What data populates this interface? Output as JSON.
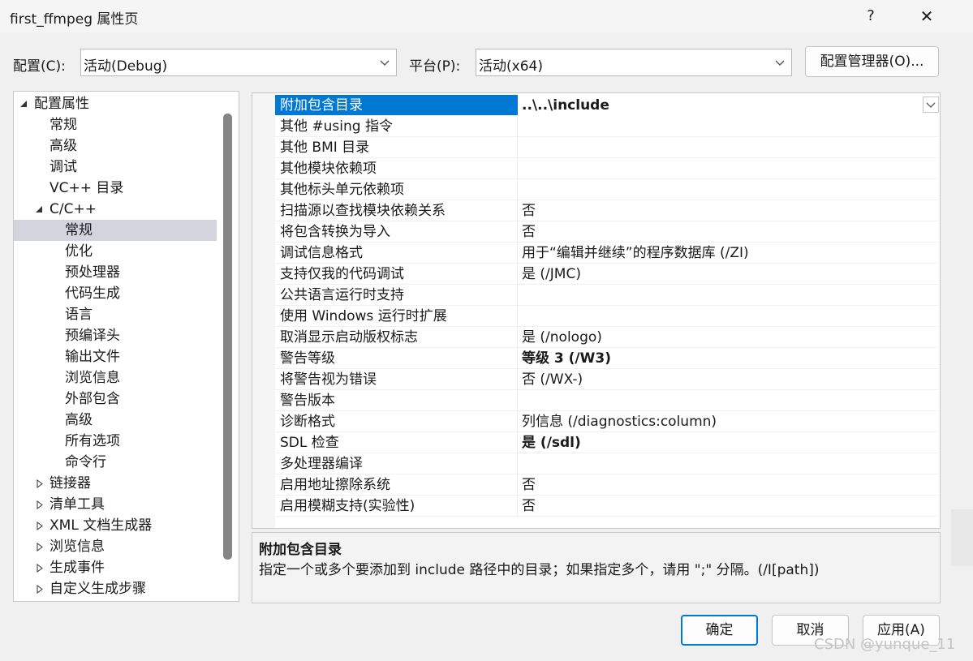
{
  "window": {
    "title": "first_ffmpeg 属性页",
    "help": "?",
    "close": "✕"
  },
  "toolbar": {
    "config_label": "配置(C):",
    "config_value": "活动(Debug)",
    "platform_label": "平台(P):",
    "platform_value": "活动(x64)",
    "manager_button": "配置管理器(O)..."
  },
  "tree": {
    "items": [
      {
        "label": "配置属性"
      },
      {
        "label": "常规"
      },
      {
        "label": "高级"
      },
      {
        "label": "调试"
      },
      {
        "label": "VC++ 目录"
      },
      {
        "label": "C/C++"
      },
      {
        "label": "常规"
      },
      {
        "label": "优化"
      },
      {
        "label": "预处理器"
      },
      {
        "label": "代码生成"
      },
      {
        "label": "语言"
      },
      {
        "label": "预编译头"
      },
      {
        "label": "输出文件"
      },
      {
        "label": "浏览信息"
      },
      {
        "label": "外部包含"
      },
      {
        "label": "高级"
      },
      {
        "label": "所有选项"
      },
      {
        "label": "命令行"
      },
      {
        "label": "链接器"
      },
      {
        "label": "清单工具"
      },
      {
        "label": "XML 文档生成器"
      },
      {
        "label": "浏览信息"
      },
      {
        "label": "生成事件"
      },
      {
        "label": "自定义生成步骤"
      }
    ]
  },
  "grid": {
    "rows": [
      {
        "name": "附加包含目录",
        "value": "..\\..\\include"
      },
      {
        "name": "其他 #using 指令",
        "value": ""
      },
      {
        "name": "其他 BMI 目录",
        "value": ""
      },
      {
        "name": "其他模块依赖项",
        "value": ""
      },
      {
        "name": "其他标头单元依赖项",
        "value": ""
      },
      {
        "name": "扫描源以查找模块依赖关系",
        "value": "否"
      },
      {
        "name": "将包含转换为导入",
        "value": "否"
      },
      {
        "name": "调试信息格式",
        "value": "用于“编辑并继续”的程序数据库 (/ZI)"
      },
      {
        "name": "支持仅我的代码调试",
        "value": "是 (/JMC)"
      },
      {
        "name": "公共语言运行时支持",
        "value": ""
      },
      {
        "name": "使用 Windows 运行时扩展",
        "value": ""
      },
      {
        "name": "取消显示启动版权标志",
        "value": "是 (/nologo)"
      },
      {
        "name": "警告等级",
        "value": "等级 3 (/W3)"
      },
      {
        "name": "将警告视为错误",
        "value": "否 (/WX-)"
      },
      {
        "name": "警告版本",
        "value": ""
      },
      {
        "name": "诊断格式",
        "value": "列信息 (/diagnostics:column)"
      },
      {
        "name": "SDL 检查",
        "value": "是 (/sdl)"
      },
      {
        "name": "多处理器编译",
        "value": ""
      },
      {
        "name": "启用地址擦除系统",
        "value": "否"
      },
      {
        "name": "启用模糊支持(实验性)",
        "value": "否"
      }
    ]
  },
  "description": {
    "title": "附加包含目录",
    "text": "指定一个或多个要添加到 include 路径中的目录；如果指定多个，请用 \";\" 分隔。(/I[path])"
  },
  "buttons": {
    "ok": "确定",
    "cancel": "取消",
    "apply": "应用(A)"
  },
  "watermark": "CSDN @yunque_11",
  "colors": {
    "selection": "#0078d4",
    "tree_selection": "#d4d4de",
    "dialog_bg": "#f0f0f0"
  }
}
